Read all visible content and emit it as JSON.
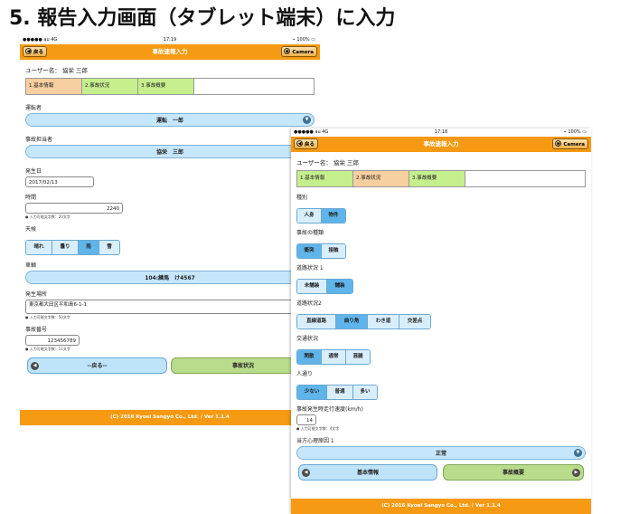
{
  "page_title": "5. 報告入力画面（タブレット端末）に入力",
  "status": {
    "carrier": "●●●●● au 4G",
    "time1": "17:19",
    "time2": "17:18",
    "battery": "100%"
  },
  "nav": {
    "title": "事故速報入力",
    "back_label": "戻る",
    "camera_label": "Camera"
  },
  "user_label": "ユーザー名：  協栄  三郎",
  "tabs": [
    "1.基本情報",
    "2.事故状況",
    "3.事故概要"
  ],
  "screen1": {
    "driver_label": "運転者",
    "driver_value": "運転　一郎",
    "handler_label": "事故担当者",
    "handler_value": "協栄　三郎",
    "date_label": "発生日",
    "date_value": "2017/02/13",
    "time_label": "時間",
    "time_value": "2240",
    "time_note": "● 入力可能文字数：20文字",
    "weather_label": "天候",
    "weather_options": [
      "晴れ",
      "曇り",
      "雨",
      "雪"
    ],
    "vehicle_label": "車輌",
    "vehicle_value": "104:練馬　け4567",
    "place_label": "発生場所",
    "place_value": "東京都大田区平和島6-1-1",
    "place_note": "● 入力可能文字数：50文字",
    "number_label": "事故番号",
    "number_value": "123456789",
    "number_note": "● 入力可能文字数：11文字",
    "prev_button": "--戻る--",
    "next_button": "事故状況"
  },
  "screen2": {
    "kind_label": "種別",
    "kind_options": [
      "人身",
      "物件"
    ],
    "type_label": "事故の種類",
    "type_options": [
      "衝突",
      "接触"
    ],
    "road1_label": "道路状況 1",
    "road1_options": [
      "未舗装",
      "舗装"
    ],
    "road2_label": "道路状況2",
    "road2_options": [
      "直線道路",
      "曲り角",
      "わき道",
      "交差点"
    ],
    "traffic_label": "交通状況",
    "traffic_options": [
      "閑散",
      "通常",
      "混雑"
    ],
    "people_label": "人通り",
    "people_options": [
      "少ない",
      "普通",
      "多い"
    ],
    "speed_label": "事故発生時走行速度(km/h)",
    "speed_value": "14",
    "speed_note": "● 入力可能文字数：4文字",
    "psych_label": "当方心理原因 1",
    "psych_value": "正常",
    "prev_button": "基本情報",
    "next_button": "事故概要"
  },
  "footer": "(C) 2016 Kyoei Sangyo Co., Ltd. / Ver 1.1.4",
  "colors": {
    "nav": "#f59a12",
    "tab_active": "#f7cfa0",
    "tab_done": "#c5ef8d",
    "pill": "#c6e6fb",
    "seg_on": "#5fb4ea",
    "green_button": "#b9dc8c"
  }
}
